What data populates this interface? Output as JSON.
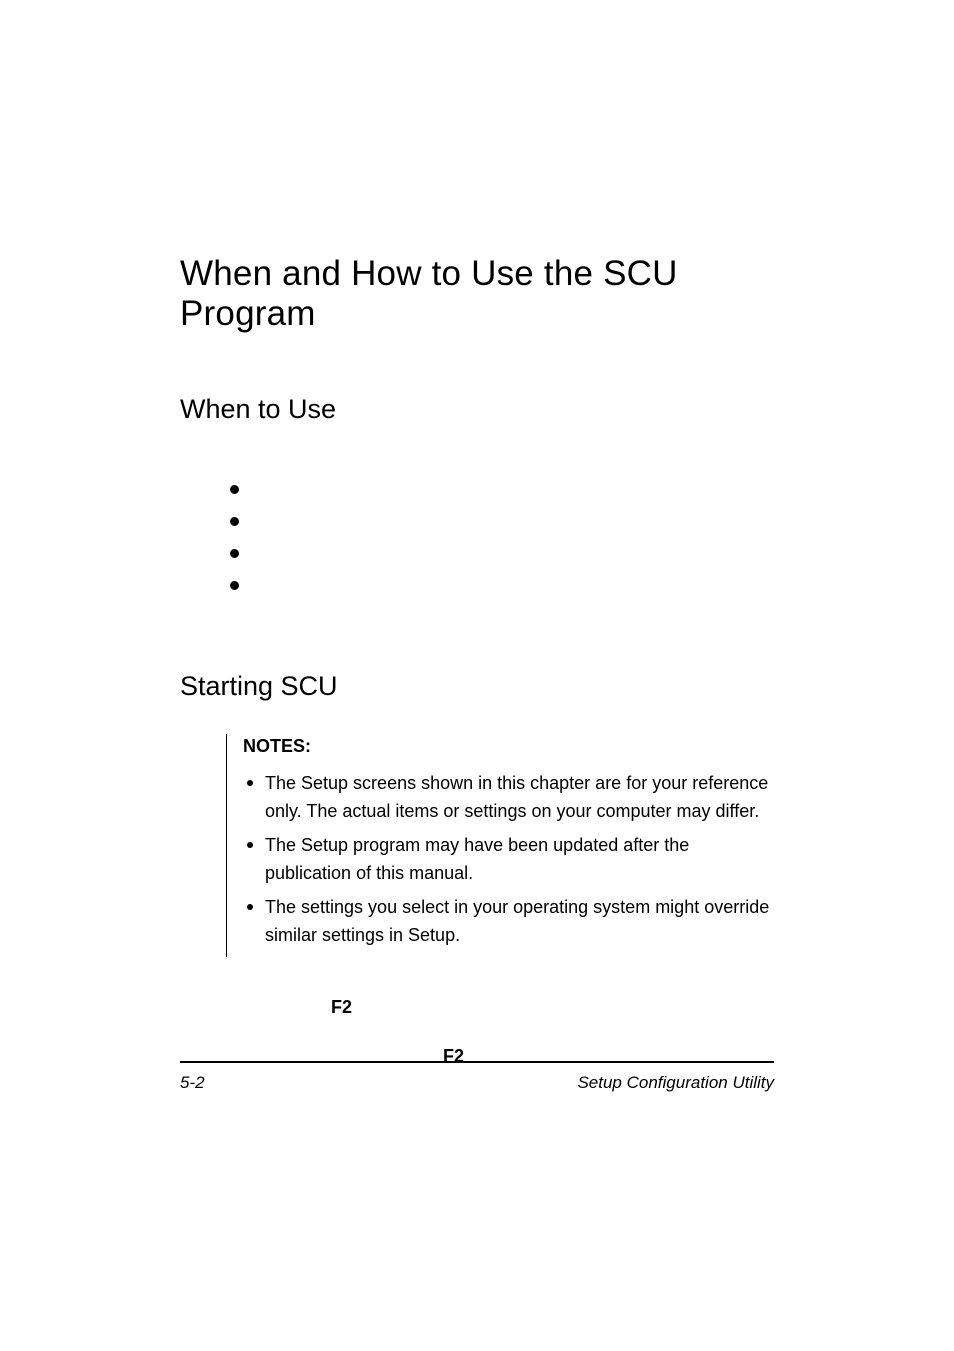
{
  "title": "When and How to Use the SCU Program",
  "sections": {
    "when_to_use": {
      "heading": "When to Use",
      "bullets": [
        "",
        "",
        "",
        ""
      ]
    },
    "starting_scu": {
      "heading": "Starting SCU",
      "notes_label": "NOTES:",
      "notes": [
        "The Setup screens shown in this chapter are for your reference only. The actual items or settings on your computer may differ.",
        "The Setup program may have been updated after the publication of this manual.",
        "The settings you select in your operating system might override similar settings in Setup."
      ],
      "key_1": "F2",
      "key_2": "F2"
    }
  },
  "footer": {
    "page_number": "5-2",
    "doc_title": "Setup Configuration Utility"
  }
}
